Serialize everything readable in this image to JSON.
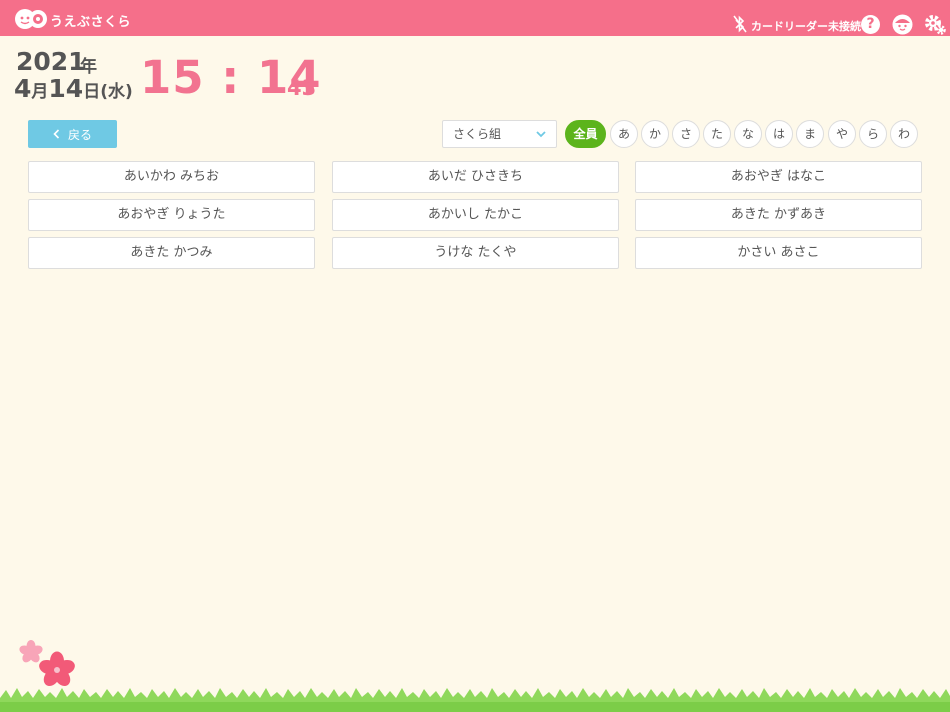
{
  "header": {
    "app_name": "うえぶさくら",
    "card_reader_status": "カードリーダー未接続",
    "help_label": "?",
    "icons": [
      "logo-icon",
      "bluetooth-off-icon",
      "help-icon",
      "user-icon",
      "gear-icon"
    ],
    "color": "#f56f8a"
  },
  "datetime": {
    "year": "2021",
    "year_unit": "年",
    "month": "4",
    "month_unit": "月",
    "day": "14",
    "day_unit": "日",
    "weekday": "(水)",
    "time": "15 : 14",
    "seconds": "43",
    "time_color": "#f27390"
  },
  "controls": {
    "back_label": "戻る",
    "class_select": "さくら組",
    "kana_filters": [
      "全員",
      "あ",
      "か",
      "さ",
      "た",
      "な",
      "は",
      "ま",
      "や",
      "ら",
      "わ"
    ],
    "active_filter": "全員",
    "accent_color": "#5cb41c",
    "back_color": "#6fc9e4"
  },
  "children": [
    "あいかわ みちお",
    "あいだ ひさきち",
    "あおやぎ はなこ",
    "あおやぎ りょうた",
    "あかいし たかこ",
    "あきた かずあき",
    "あきた かつみ",
    "うけな たくや",
    "かさい あさこ"
  ]
}
